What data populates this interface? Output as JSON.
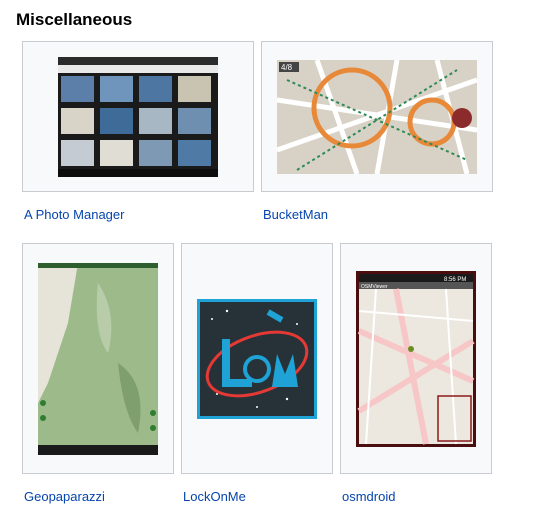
{
  "section": {
    "title": "Miscellaneous"
  },
  "apps": [
    {
      "name": "A Photo Manager"
    },
    {
      "name": "BucketMan"
    },
    {
      "name": "Geopaparazzi"
    },
    {
      "name": "LockOnMe"
    },
    {
      "name": "osmdroid"
    }
  ],
  "bucketman_screen": {
    "zoom": "4/8"
  },
  "osmdroid_screen": {
    "time": "8:56 PM",
    "app_title": "OSMViewer"
  },
  "colors": {
    "link": "#0645ad",
    "tile_bg": "#f8f9fa",
    "tile_border": "#c8ccd1",
    "lockonme_bg": "#263238",
    "lockonme_frame": "#1fa3d6",
    "lockonme_orbit": "#e53935"
  }
}
